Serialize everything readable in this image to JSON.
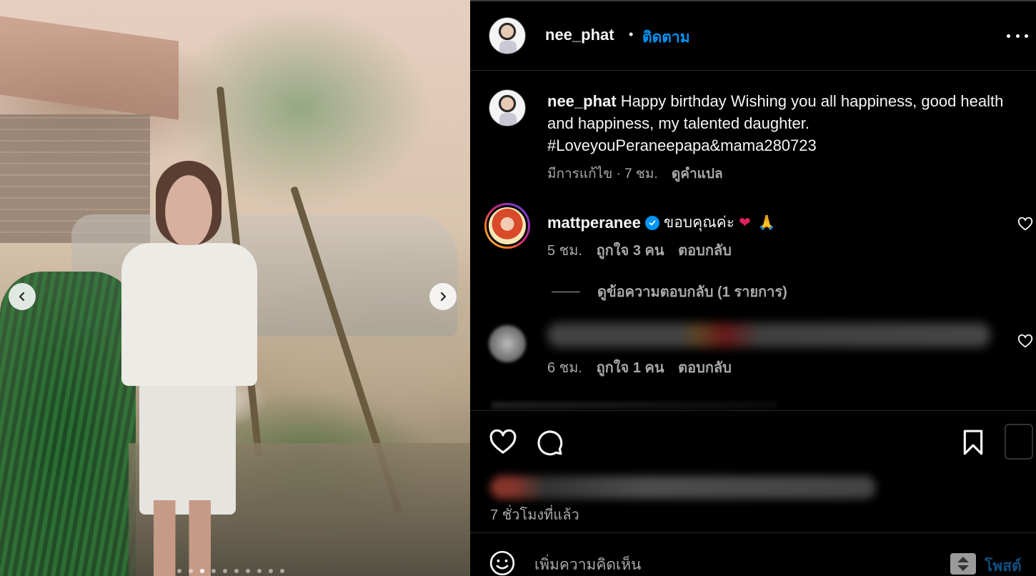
{
  "post": {
    "username": "nee_phat",
    "separator": "•",
    "follow_label": "ติดตาม",
    "caption_text": " Happy birthday Wishing you all happiness, good health and happiness, my talented daughter. #LoveyouPeraneepapa&mama280723",
    "caption_meta": "มีการแก้ไข · 7 ชม.",
    "translate_label": "ดูคำแปล"
  },
  "photo": {
    "current_slide": 3,
    "total_slides": 10
  },
  "comments": [
    {
      "username": "mattperanee",
      "verified": true,
      "text": "ขอบคุณค่ะ",
      "emoji": [
        "red-heart",
        "praying-hands"
      ],
      "time": "5 ชม.",
      "likes": "ถูกใจ 3 คน",
      "reply_label": "ตอบกลับ",
      "view_replies": "ดูข้อความตอบกลับ (1 รายการ)"
    },
    {
      "time": "6 ชม.",
      "likes": "ถูกใจ 1 คน",
      "reply_label": "ตอบกลับ"
    }
  ],
  "footer": {
    "time_ago": "7 ชั่วโมงที่แล้ว",
    "comment_placeholder": "เพิ่มความคิดเห็น",
    "post_label": "โพสต์"
  },
  "colors": {
    "background": "#000000",
    "link_blue": "#0095f6",
    "muted_text": "#a8a8a8"
  }
}
